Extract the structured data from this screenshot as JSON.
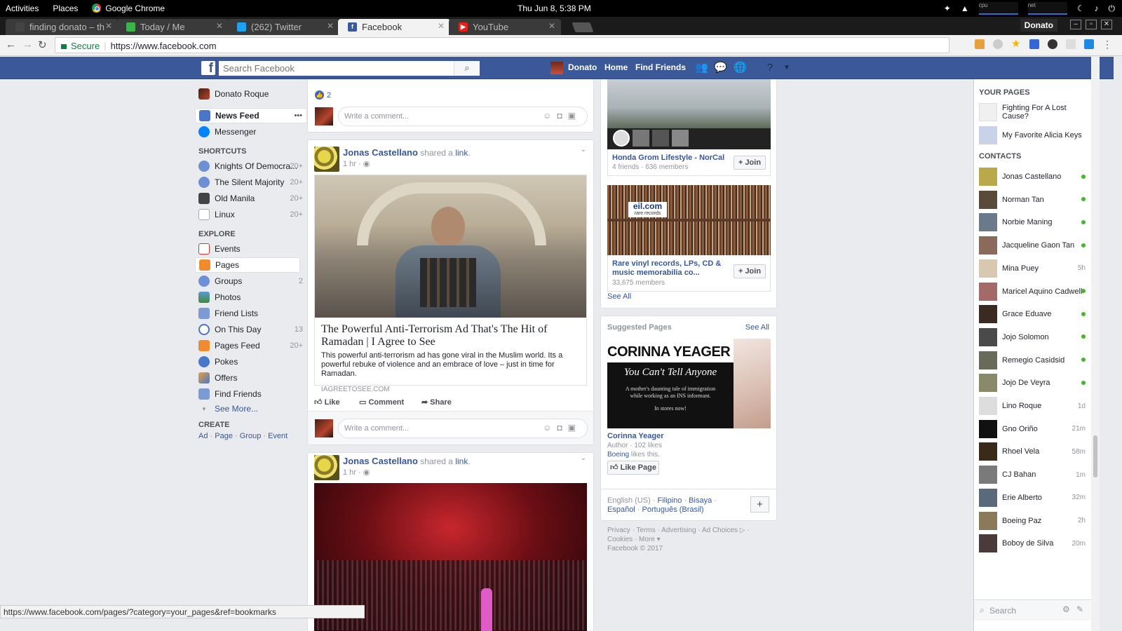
{
  "gnome": {
    "activities": "Activities",
    "places": "Places",
    "app": "Google Chrome",
    "clock": "Thu Jun  8,  5:38 PM",
    "cpu": "cpu",
    "net": "net"
  },
  "tabs": [
    {
      "label": "finding donato – th",
      "color": "#444"
    },
    {
      "label": "Today / Me",
      "color": "#3bb54a"
    },
    {
      "label": "(262) Twitter",
      "color": "#1da1f2"
    },
    {
      "label": "Facebook",
      "color": "#3b5998"
    },
    {
      "label": "YouTube",
      "color": "#e62117"
    }
  ],
  "window": {
    "user": "Donato"
  },
  "omnibar": {
    "secure": "Secure",
    "url": "https://www.facebook.com"
  },
  "fb": {
    "logo": "f",
    "search_placeholder": "Search Facebook",
    "user": "Donato",
    "home": "Home",
    "find_friends": "Find Friends"
  },
  "left": {
    "profile": "Donato Roque",
    "news_feed": "News Feed",
    "more": "•••",
    "messenger": "Messenger",
    "shortcuts_head": "SHORTCUTS",
    "shortcuts": [
      {
        "label": "Knights Of Democra...",
        "count": "20+"
      },
      {
        "label": "The Silent Majority",
        "count": "20+"
      },
      {
        "label": "Old Manila",
        "count": "20+"
      },
      {
        "label": "Linux",
        "count": "20+"
      }
    ],
    "explore_head": "EXPLORE",
    "explore": [
      {
        "label": "Events",
        "count": ""
      },
      {
        "label": "Pages",
        "count": ""
      },
      {
        "label": "Groups",
        "count": "2"
      },
      {
        "label": "Photos",
        "count": ""
      },
      {
        "label": "Friend Lists",
        "count": ""
      },
      {
        "label": "On This Day",
        "count": "13"
      },
      {
        "label": "Pages Feed",
        "count": "20+"
      },
      {
        "label": "Pokes",
        "count": ""
      },
      {
        "label": "Offers",
        "count": ""
      },
      {
        "label": "Find Friends",
        "count": ""
      }
    ],
    "see_more": "See More...",
    "create_head": "CREATE",
    "create": [
      "Ad",
      "Page",
      "Group",
      "Event"
    ]
  },
  "feed": {
    "likes": "2",
    "comment_placeholder": "Write a comment...",
    "post1": {
      "author": "Jonas Castellano",
      "shared": "shared a",
      "link": "link",
      "time": "1 hr",
      "title": "The Powerful Anti-Terrorism Ad That's The Hit of Ramadan | I Agree to See",
      "desc": "This powerful anti-terrorism ad has gone viral in the Muslim world. Its a powerful rebuke of violence and an embrace of love – just in time for Ramadan.",
      "domain": "IAGREETOSEE.COM"
    },
    "like": "Like",
    "comment": "Comment",
    "share": "Share",
    "post2": {
      "author": "Jonas Castellano",
      "shared": "shared a",
      "link": "link",
      "time": "1 hr"
    }
  },
  "groups": [
    {
      "name": "Honda Grom Lifestyle - NorCal",
      "meta": "4 friends · 636 members",
      "join": "Join"
    },
    {
      "name": "Rare vinyl records, LPs, CD & music memorabilia co...",
      "meta": "33,675 members",
      "join": "Join",
      "banner": "eil.com",
      "banner_sub": "rare records"
    }
  ],
  "see_all": "See All",
  "suggested": {
    "head": "Suggested Pages",
    "see_all": "See All",
    "ad_title": "CORINNA YEAGER",
    "ad_sub": "You Can't Tell Anyone",
    "ad_line": "A mother's daunting tale of immigration while working as an INS informant.",
    "ad_stores": "In stores now!",
    "name": "Corinna Yeager",
    "meta": "Author · 102 likes",
    "liker": "Boeing",
    "likes_this": "likes this.",
    "like_page": "Like Page"
  },
  "langs": {
    "current": "English (US)",
    "others": [
      "Filipino",
      "Bisaya",
      "Español",
      "Português (Brasil)"
    ]
  },
  "footer": {
    "links": [
      "Privacy",
      "Terms",
      "Advertising",
      "Ad Choices",
      "Cookies",
      "More"
    ],
    "copyright": "Facebook © 2017"
  },
  "chat": {
    "your_pages": "YOUR PAGES",
    "pages": [
      "Fighting For A Lost Cause?",
      "My Favorite Alicia Keys"
    ],
    "contacts_head": "CONTACTS",
    "contacts": [
      {
        "name": "Jonas Castellano",
        "status": "online"
      },
      {
        "name": "Norman Tan",
        "status": "online"
      },
      {
        "name": "Norbie Maning",
        "status": "online"
      },
      {
        "name": "Jacqueline Gaon Tan",
        "status": "online"
      },
      {
        "name": "Mina Puey",
        "status": "5h"
      },
      {
        "name": "Maricel Aquino Cadwell",
        "status": "online"
      },
      {
        "name": "Grace Eduave",
        "status": "online"
      },
      {
        "name": "Jojo Solomon",
        "status": "online"
      },
      {
        "name": "Remegio Casidsid",
        "status": "online"
      },
      {
        "name": "Jojo De Veyra",
        "status": "online"
      },
      {
        "name": "Lino Roque",
        "status": "1d"
      },
      {
        "name": "Gno Oriño",
        "status": "21m"
      },
      {
        "name": "Rhoel Vela",
        "status": "58m"
      },
      {
        "name": "CJ Bahan",
        "status": "1m"
      },
      {
        "name": "Erie Alberto",
        "status": "32m"
      },
      {
        "name": "Boeing Paz",
        "status": "2h"
      },
      {
        "name": "Boboy de Silva",
        "status": "20m"
      }
    ],
    "search": "Search"
  },
  "status_url": "https://www.facebook.com/pages/?category=your_pages&ref=bookmarks"
}
